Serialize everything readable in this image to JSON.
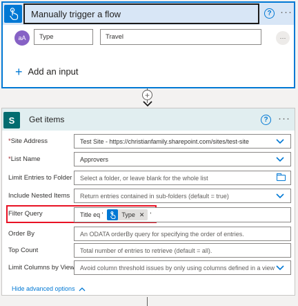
{
  "trigger": {
    "title": "Manually trigger a flow",
    "help_icon": "question-icon",
    "more_icon": "ellipsis-icon",
    "input": {
      "avatar_text": "aA",
      "name_value": "Type",
      "value_value": "Travel"
    },
    "add_input_label": "Add an input"
  },
  "connector": {
    "plus_icon": "plus-icon",
    "arrow_icon": "arrow-down-icon"
  },
  "action": {
    "title": "Get items",
    "icon": "sharepoint-icon",
    "icon_letter": "S",
    "fields": {
      "site_address": {
        "label": "Site Address",
        "required": "*",
        "value": "Test Site - https://christianfamily.sharepoint.com/sites/test-site"
      },
      "list_name": {
        "label": "List Name",
        "required": "*",
        "value": "Approvers"
      },
      "limit_folder": {
        "label": "Limit Entries to Folder",
        "placeholder": "Select a folder, or leave blank for the whole list"
      },
      "nested_items": {
        "label": "Include Nested Items",
        "placeholder": "Return entries contained in sub-folders (default = true)"
      },
      "filter_query": {
        "label": "Filter Query",
        "prefix": "Title eq '",
        "token": "Type",
        "suffix": "'"
      },
      "order_by": {
        "label": "Order By",
        "placeholder": "An ODATA orderBy query for specifying the order of entries."
      },
      "top_count": {
        "label": "Top Count",
        "placeholder": "Total number of entries to retrieve (default = all)."
      },
      "limit_columns": {
        "label": "Limit Columns by View",
        "placeholder": "Avoid column threshold issues by only using columns defined in a view"
      }
    },
    "hide_advanced_label": "Hide advanced options"
  },
  "colors": {
    "accent": "#0078d4",
    "highlight_border": "#e81123",
    "trigger_header": "#d8e6f6",
    "action_header": "#e1eef0",
    "sharepoint": "#036c70"
  }
}
